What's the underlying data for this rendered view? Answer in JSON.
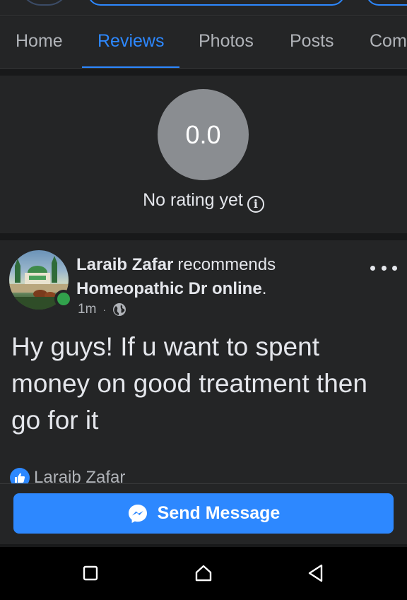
{
  "tabs": [
    {
      "label": "Home",
      "active": false
    },
    {
      "label": "Reviews",
      "active": true
    },
    {
      "label": "Photos",
      "active": false
    },
    {
      "label": "Posts",
      "active": false
    },
    {
      "label": "Com",
      "active": false
    }
  ],
  "rating": {
    "score": "0.0",
    "label": "No rating yet"
  },
  "review": {
    "author": "Laraib Zafar",
    "action": "recommends",
    "page": "Homeopathic Dr online",
    "page_suffix": ".",
    "time": "1m",
    "separator": "·",
    "audience_icon": "globe-icon",
    "text": "Hy guys! If u want to spent money on good treatment then go for it",
    "reaction_name": "Laraib Zafar",
    "reaction_icon": "like-icon"
  },
  "send_button": {
    "label": "Send Message",
    "icon": "messenger-icon"
  },
  "navigation": {
    "recents_icon": "square-icon",
    "home_icon": "home-icon",
    "back_icon": "back-triangle-icon"
  },
  "colors": {
    "accent": "#2d88ff",
    "background": "#18191a",
    "card": "#242526",
    "online": "#31a24c",
    "rating_circle": "#8a8d91"
  }
}
